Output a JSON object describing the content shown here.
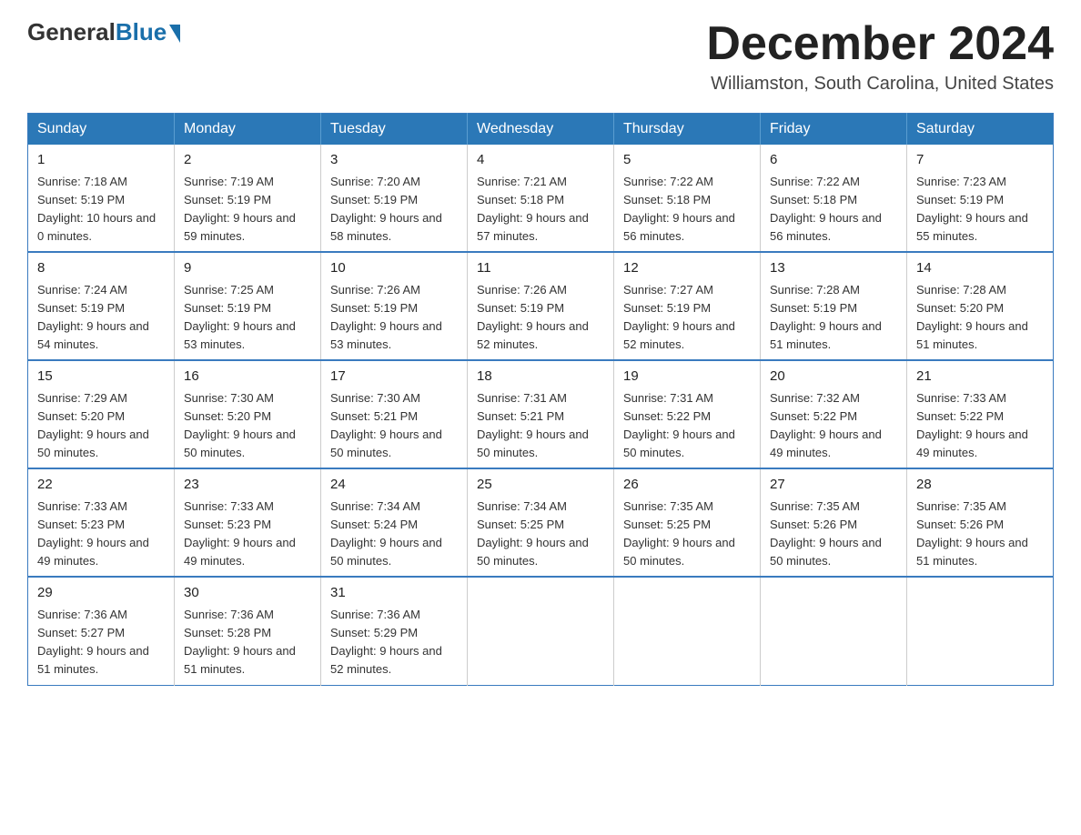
{
  "logo": {
    "general": "General",
    "blue": "Blue",
    "triangle": "▲"
  },
  "header": {
    "title": "December 2024",
    "subtitle": "Williamston, South Carolina, United States"
  },
  "weekdays": [
    "Sunday",
    "Monday",
    "Tuesday",
    "Wednesday",
    "Thursday",
    "Friday",
    "Saturday"
  ],
  "weeks": [
    [
      {
        "day": "1",
        "sunrise": "7:18 AM",
        "sunset": "5:19 PM",
        "daylight": "10 hours and 0 minutes."
      },
      {
        "day": "2",
        "sunrise": "7:19 AM",
        "sunset": "5:19 PM",
        "daylight": "9 hours and 59 minutes."
      },
      {
        "day": "3",
        "sunrise": "7:20 AM",
        "sunset": "5:19 PM",
        "daylight": "9 hours and 58 minutes."
      },
      {
        "day": "4",
        "sunrise": "7:21 AM",
        "sunset": "5:18 PM",
        "daylight": "9 hours and 57 minutes."
      },
      {
        "day": "5",
        "sunrise": "7:22 AM",
        "sunset": "5:18 PM",
        "daylight": "9 hours and 56 minutes."
      },
      {
        "day": "6",
        "sunrise": "7:22 AM",
        "sunset": "5:18 PM",
        "daylight": "9 hours and 56 minutes."
      },
      {
        "day": "7",
        "sunrise": "7:23 AM",
        "sunset": "5:19 PM",
        "daylight": "9 hours and 55 minutes."
      }
    ],
    [
      {
        "day": "8",
        "sunrise": "7:24 AM",
        "sunset": "5:19 PM",
        "daylight": "9 hours and 54 minutes."
      },
      {
        "day": "9",
        "sunrise": "7:25 AM",
        "sunset": "5:19 PM",
        "daylight": "9 hours and 53 minutes."
      },
      {
        "day": "10",
        "sunrise": "7:26 AM",
        "sunset": "5:19 PM",
        "daylight": "9 hours and 53 minutes."
      },
      {
        "day": "11",
        "sunrise": "7:26 AM",
        "sunset": "5:19 PM",
        "daylight": "9 hours and 52 minutes."
      },
      {
        "day": "12",
        "sunrise": "7:27 AM",
        "sunset": "5:19 PM",
        "daylight": "9 hours and 52 minutes."
      },
      {
        "day": "13",
        "sunrise": "7:28 AM",
        "sunset": "5:19 PM",
        "daylight": "9 hours and 51 minutes."
      },
      {
        "day": "14",
        "sunrise": "7:28 AM",
        "sunset": "5:20 PM",
        "daylight": "9 hours and 51 minutes."
      }
    ],
    [
      {
        "day": "15",
        "sunrise": "7:29 AM",
        "sunset": "5:20 PM",
        "daylight": "9 hours and 50 minutes."
      },
      {
        "day": "16",
        "sunrise": "7:30 AM",
        "sunset": "5:20 PM",
        "daylight": "9 hours and 50 minutes."
      },
      {
        "day": "17",
        "sunrise": "7:30 AM",
        "sunset": "5:21 PM",
        "daylight": "9 hours and 50 minutes."
      },
      {
        "day": "18",
        "sunrise": "7:31 AM",
        "sunset": "5:21 PM",
        "daylight": "9 hours and 50 minutes."
      },
      {
        "day": "19",
        "sunrise": "7:31 AM",
        "sunset": "5:22 PM",
        "daylight": "9 hours and 50 minutes."
      },
      {
        "day": "20",
        "sunrise": "7:32 AM",
        "sunset": "5:22 PM",
        "daylight": "9 hours and 49 minutes."
      },
      {
        "day": "21",
        "sunrise": "7:33 AM",
        "sunset": "5:22 PM",
        "daylight": "9 hours and 49 minutes."
      }
    ],
    [
      {
        "day": "22",
        "sunrise": "7:33 AM",
        "sunset": "5:23 PM",
        "daylight": "9 hours and 49 minutes."
      },
      {
        "day": "23",
        "sunrise": "7:33 AM",
        "sunset": "5:23 PM",
        "daylight": "9 hours and 49 minutes."
      },
      {
        "day": "24",
        "sunrise": "7:34 AM",
        "sunset": "5:24 PM",
        "daylight": "9 hours and 50 minutes."
      },
      {
        "day": "25",
        "sunrise": "7:34 AM",
        "sunset": "5:25 PM",
        "daylight": "9 hours and 50 minutes."
      },
      {
        "day": "26",
        "sunrise": "7:35 AM",
        "sunset": "5:25 PM",
        "daylight": "9 hours and 50 minutes."
      },
      {
        "day": "27",
        "sunrise": "7:35 AM",
        "sunset": "5:26 PM",
        "daylight": "9 hours and 50 minutes."
      },
      {
        "day": "28",
        "sunrise": "7:35 AM",
        "sunset": "5:26 PM",
        "daylight": "9 hours and 51 minutes."
      }
    ],
    [
      {
        "day": "29",
        "sunrise": "7:36 AM",
        "sunset": "5:27 PM",
        "daylight": "9 hours and 51 minutes."
      },
      {
        "day": "30",
        "sunrise": "7:36 AM",
        "sunset": "5:28 PM",
        "daylight": "9 hours and 51 minutes."
      },
      {
        "day": "31",
        "sunrise": "7:36 AM",
        "sunset": "5:29 PM",
        "daylight": "9 hours and 52 minutes."
      },
      null,
      null,
      null,
      null
    ]
  ]
}
